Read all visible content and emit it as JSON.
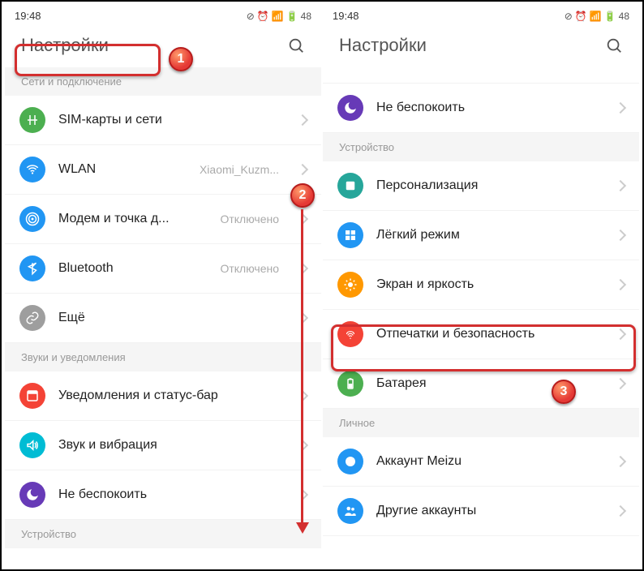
{
  "statusbar": {
    "time": "19:48",
    "battery": "48"
  },
  "left": {
    "title": "Настройки",
    "sections": {
      "network": "Сети и подключение",
      "sounds": "Звуки и уведомления",
      "device": "Устройство"
    },
    "items": {
      "sim": {
        "label": "SIM-карты и сети",
        "value": ""
      },
      "wlan": {
        "label": "WLAN",
        "value": "Xiaomi_Kuzm..."
      },
      "hotspot": {
        "label": "Модем и точка д...",
        "value": "Отключено"
      },
      "bluetooth": {
        "label": "Bluetooth",
        "value": "Отключено"
      },
      "more": {
        "label": "Ещё",
        "value": ""
      },
      "notif": {
        "label": "Уведомления и статус-бар",
        "value": ""
      },
      "sound": {
        "label": "Звук и вибрация",
        "value": ""
      },
      "dnd": {
        "label": "Не беспокоить",
        "value": ""
      }
    }
  },
  "right": {
    "title": "Настройки",
    "sections": {
      "device": "Устройство",
      "personal": "Личное"
    },
    "items": {
      "dnd": {
        "label": "Не беспокоить",
        "value": ""
      },
      "personalize": {
        "label": "Персонализация",
        "value": ""
      },
      "easy": {
        "label": "Лёгкий режим",
        "value": ""
      },
      "display": {
        "label": "Экран и яркость",
        "value": ""
      },
      "fingerprint": {
        "label": "Отпечатки и безопасность",
        "value": ""
      },
      "battery": {
        "label": "Батарея",
        "value": ""
      },
      "account": {
        "label": "Аккаунт Meizu",
        "value": ""
      },
      "other_acc": {
        "label": "Другие аккаунты",
        "value": ""
      }
    }
  },
  "colors": {
    "green": "#4caf50",
    "blue": "#2196f3",
    "teal": "#4caf50",
    "grey": "#9e9e9e",
    "red": "#f44336",
    "purple": "#673ab7",
    "cyan": "#00bcd4",
    "indigo": "#3f51b5",
    "orange": "#ff9800",
    "deeporange": "#ff5722",
    "lime": "#26a69a"
  }
}
